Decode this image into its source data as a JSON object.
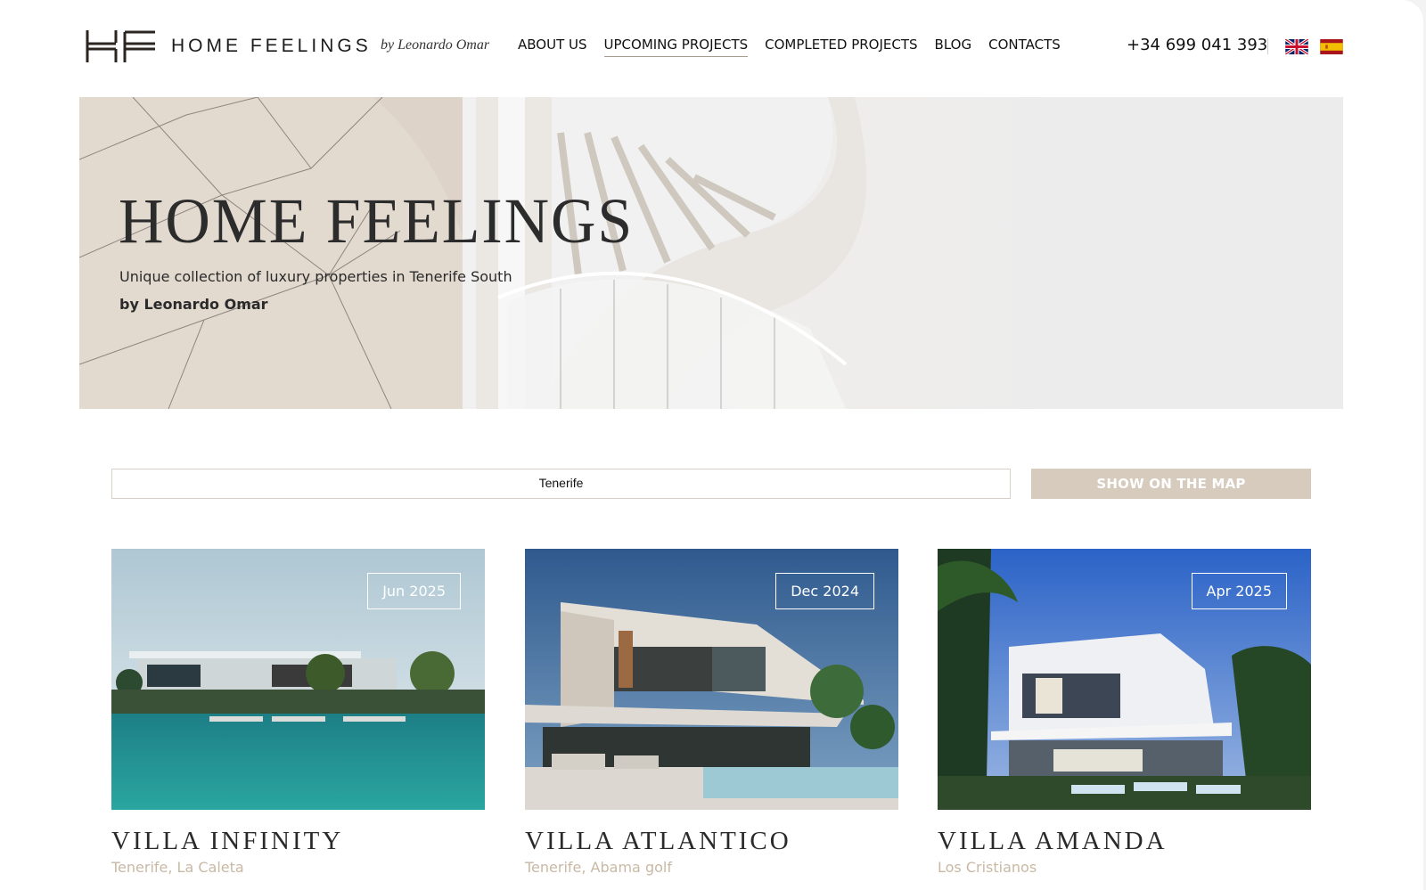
{
  "header": {
    "logo_title": "HOME FEELINGS",
    "logo_by": "by Leonardo Omar",
    "nav": [
      {
        "label": "ABOUT US"
      },
      {
        "label": "UPCOMING PROJECTS",
        "active": true
      },
      {
        "label": "COMPLETED PROJECTS"
      },
      {
        "label": "BLOG"
      },
      {
        "label": "CONTACTS"
      }
    ],
    "phone": "+34 699 041 393",
    "languages": [
      "uk-flag-icon",
      "spain-flag-icon"
    ]
  },
  "hero": {
    "title": "HOME FEELINGS",
    "subtitle": "Unique collection of luxury properties in Tenerife South",
    "by": "by Leonardo Omar"
  },
  "search": {
    "value": "Tenerife",
    "map_button": "SHOW ON THE MAP"
  },
  "cards": [
    {
      "title": "VILLA INFINITY",
      "location": "Tenerife, La Caleta",
      "date": "Jun 2025"
    },
    {
      "title": "VILLA ATLANTICO",
      "location": "Tenerife, Abama golf",
      "date": "Dec 2024"
    },
    {
      "title": "VILLA AMANDA",
      "location": "Los Cristianos",
      "date": "Apr 2025"
    }
  ],
  "colors": {
    "accent": "#d6cbbd",
    "location_text": "#c9b9a4",
    "nav_underline": "#a79b8d"
  }
}
